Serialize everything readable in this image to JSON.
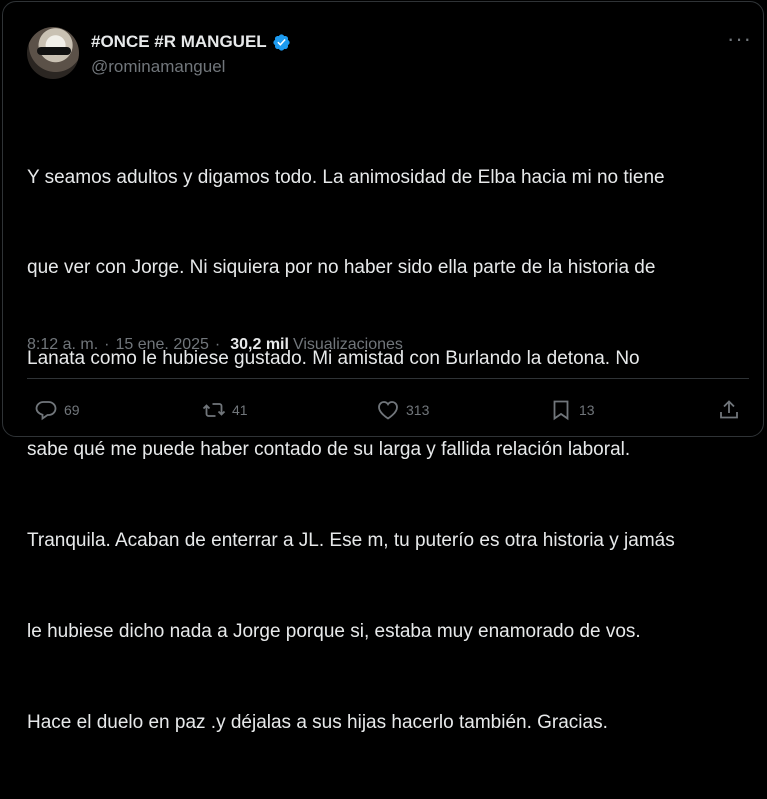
{
  "author": {
    "display_name": "#ONCE #R MANGUEL",
    "handle": "@rominamanguel",
    "verified_icon": "verified-badge-icon",
    "accent_color": "#1d9bf0"
  },
  "tweet": {
    "lines": [
      "Y seamos adultos y digamos todo. La animosidad de Elba hacia mi no tiene",
      "que ver con Jorge. Ni siquiera por no haber sido ella parte de la historia de",
      "Lanata como le hubiese gustado. Mi amistad con Burlando la detona. No",
      "sabe qué me puede haber contado de su larga y fallida relación laboral.",
      "Tranquila. Acaban de enterrar a JL. Ese m, tu puterío es otra historia y jamás",
      "le hubiese dicho nada a Jorge porque si, estaba muy enamorado de vos.",
      "Hace el duelo en paz .y déjalas a sus hijas hacerlo también. Gracias."
    ]
  },
  "meta": {
    "time": "8:12 a. m.",
    "separator": "·",
    "date": "15 ene. 2025",
    "views_count": "30,2 mil",
    "views_label": "Visualizaciones"
  },
  "actions": {
    "replies": "69",
    "retweets": "41",
    "likes": "313",
    "bookmarks": "13"
  },
  "more_label": "···"
}
